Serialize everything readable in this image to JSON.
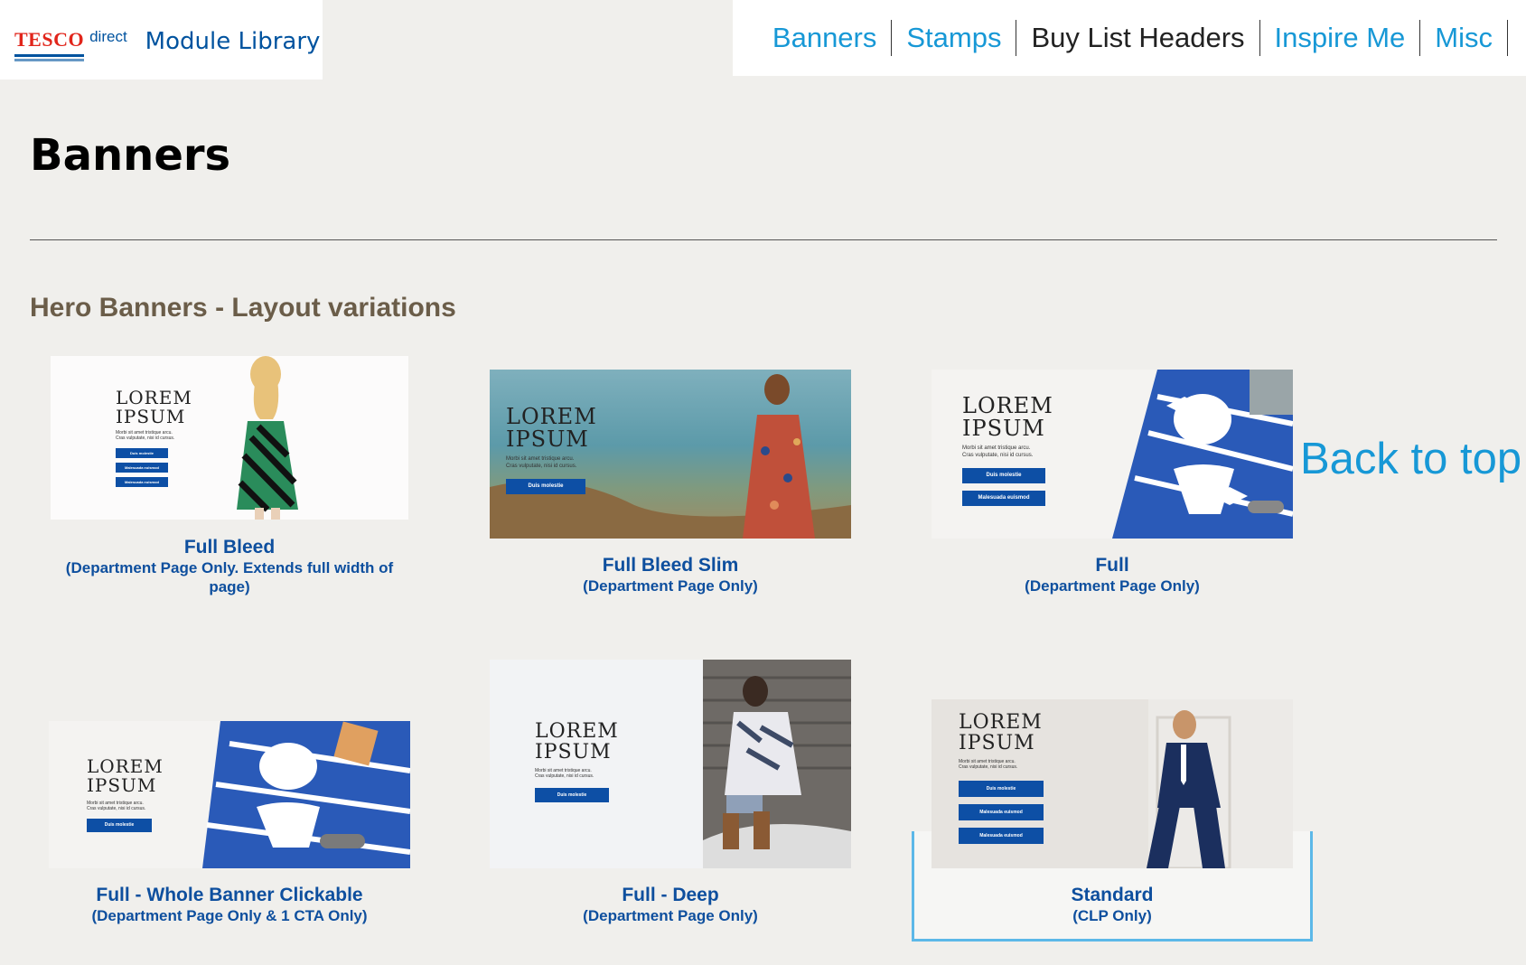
{
  "header": {
    "brand": "TESCO",
    "brand_sub": "direct",
    "library_title": "Module Library"
  },
  "nav": {
    "items": [
      {
        "label": "Banners"
      },
      {
        "label": "Stamps"
      },
      {
        "label": "Buy List Headers"
      },
      {
        "label": "Inspire Me"
      },
      {
        "label": "Misc"
      }
    ]
  },
  "page": {
    "title": "Banners",
    "section_title": "Hero Banners - Layout variations",
    "back_to_top": "Back to top"
  },
  "banner_copy": {
    "lorem1": "LOREM",
    "lorem2": "IPSUM",
    "body1": "Morbi sit amet tristique arcu.",
    "body2": "Cras vulputate, nisi id cursus.",
    "cta1": "Duis molestie",
    "cta2": "Malesuada euismod",
    "cta3": "Malesuada euismod"
  },
  "cards": [
    {
      "title": "Full Bleed",
      "subtitle": "(Department Page Only. Extends full width of page)"
    },
    {
      "title": "Full Bleed Slim",
      "subtitle": "(Department Page Only)"
    },
    {
      "title": "Full",
      "subtitle": "(Department Page Only)"
    },
    {
      "title": "Full - Whole Banner Clickable",
      "subtitle": "(Department Page Only & 1 CTA Only)"
    },
    {
      "title": "Full - Deep",
      "subtitle": "(Department Page Only)"
    },
    {
      "title": "Standard",
      "subtitle": "(CLP Only)"
    }
  ],
  "colors": {
    "accent": "#1798d6",
    "brand_blue": "#00539f",
    "cta_blue": "#0d4fa5",
    "section_brown": "#6b5d49",
    "page_bg": "#f0efec"
  }
}
